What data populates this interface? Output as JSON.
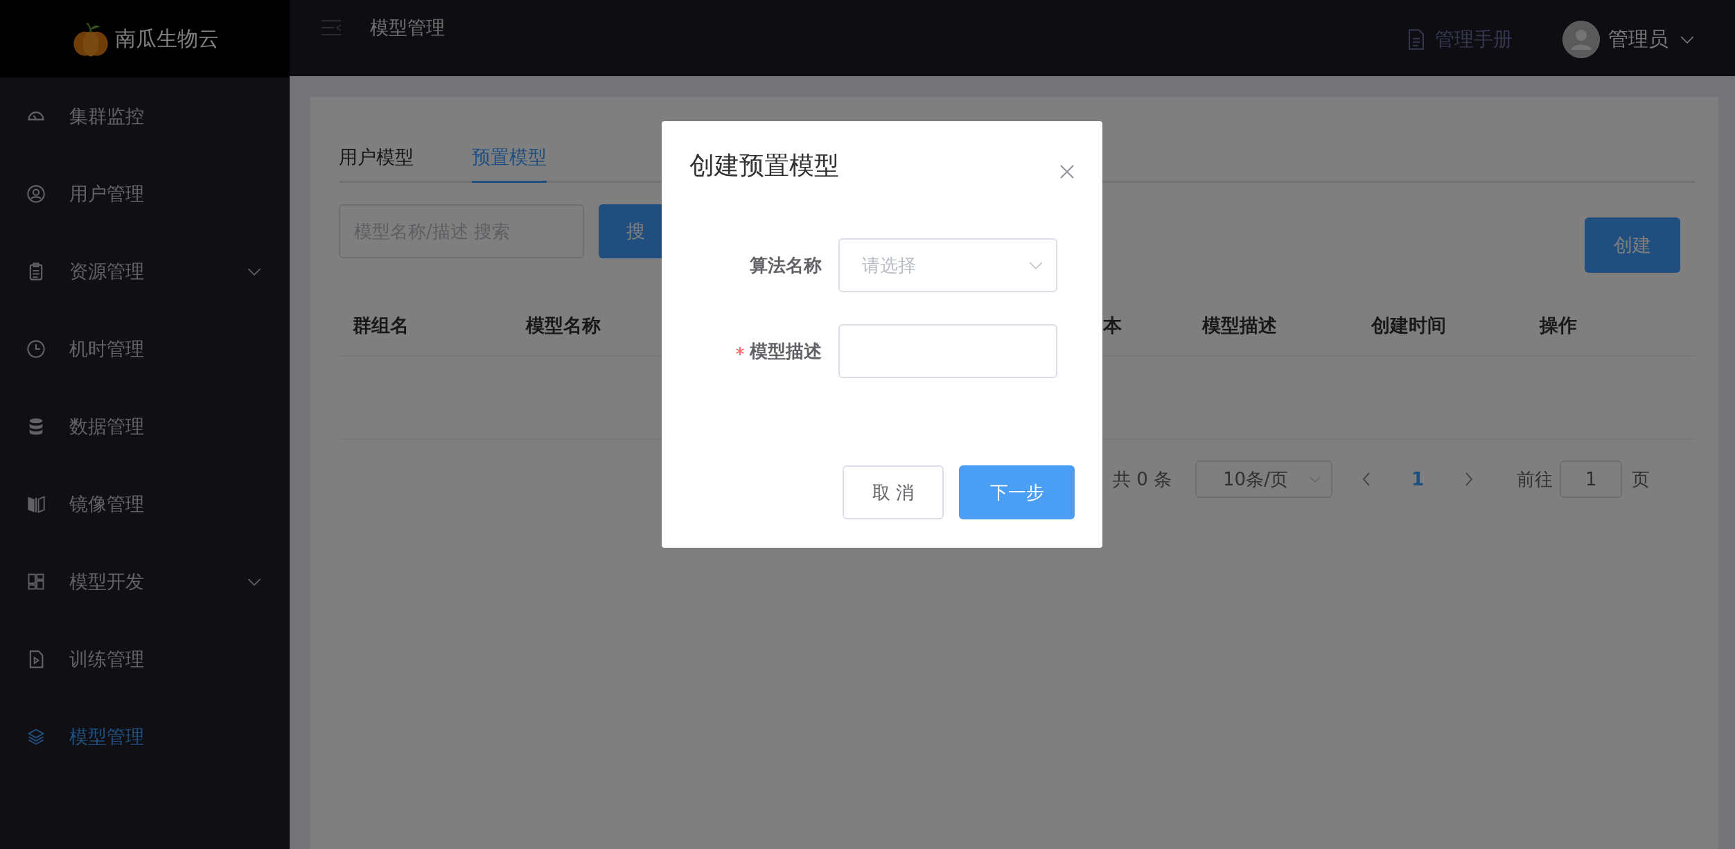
{
  "brand": {
    "name": "南瓜生物云"
  },
  "sidebar": {
    "items": [
      {
        "label": "集群监控",
        "selected": false,
        "expandable": false
      },
      {
        "label": "用户管理",
        "selected": false,
        "expandable": false
      },
      {
        "label": "资源管理",
        "selected": false,
        "expandable": true
      },
      {
        "label": "机时管理",
        "selected": false,
        "expandable": false
      },
      {
        "label": "数据管理",
        "selected": false,
        "expandable": false
      },
      {
        "label": "镜像管理",
        "selected": false,
        "expandable": false
      },
      {
        "label": "模型开发",
        "selected": false,
        "expandable": true
      },
      {
        "label": "训练管理",
        "selected": false,
        "expandable": false
      },
      {
        "label": "模型管理",
        "selected": true,
        "expandable": false
      }
    ]
  },
  "header": {
    "title": "模型管理",
    "manual": "管理手册",
    "user": "管理员"
  },
  "tabs": [
    {
      "label": "用户模型",
      "selected": false
    },
    {
      "label": "预置模型",
      "selected": true
    }
  ],
  "search": {
    "placeholder": "模型名称/描述 搜索",
    "button": "搜"
  },
  "create_button": "创建",
  "table": {
    "columns": [
      "群组名",
      "模型名称",
      "本",
      "模型描述",
      "创建时间",
      "操作"
    ]
  },
  "pagination": {
    "total": "共 0 条",
    "page_size": "10条/页",
    "pages": [
      {
        "label": "1",
        "selected": true
      }
    ],
    "goto_label": "前往",
    "goto_value": "1",
    "page_suffix": "页"
  },
  "dialog": {
    "title": "创建预置模型",
    "fields": [
      {
        "kind": "select",
        "label": "算法名称",
        "placeholder": "请选择",
        "required": false
      },
      {
        "kind": "textarea",
        "label": "模型描述",
        "required": true
      }
    ],
    "buttons": [
      {
        "label": "取 消",
        "kind": "default"
      },
      {
        "label": "下一步",
        "kind": "primary"
      }
    ]
  }
}
